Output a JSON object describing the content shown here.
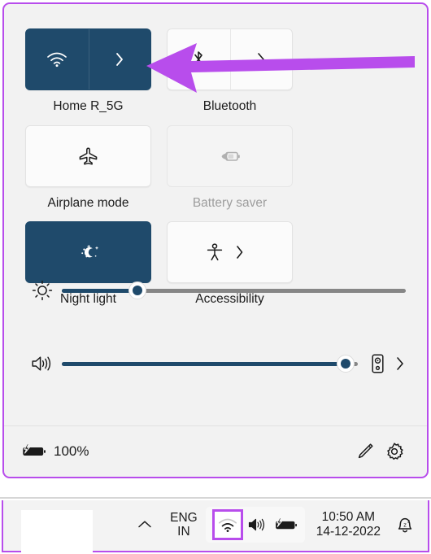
{
  "panel": {
    "name": "quick-settings",
    "accent_on_color": "#1f4a6b",
    "annotation_color": "#b84dec",
    "tiles": [
      {
        "id": "wifi",
        "label": "Home R_5G",
        "icon": "wifi-icon",
        "state": "on",
        "has_chevron": true,
        "chevron": "›"
      },
      {
        "id": "bluetooth",
        "label": "Bluetooth",
        "icon": "bluetooth-icon",
        "state": "off",
        "has_chevron": true,
        "chevron": "›"
      },
      {
        "id": "airplane-mode",
        "label": "Airplane mode",
        "icon": "airplane-icon",
        "state": "off",
        "has_chevron": false,
        "chevron": ""
      },
      {
        "id": "battery-saver",
        "label": "Battery saver",
        "icon": "battery-saver-icon",
        "state": "disabled",
        "has_chevron": false,
        "chevron": ""
      },
      {
        "id": "night-light",
        "label": "Night light",
        "icon": "moon-stars-icon",
        "state": "on",
        "has_chevron": false,
        "chevron": ""
      },
      {
        "id": "accessibility",
        "label": "Accessibility",
        "icon": "accessibility-icon",
        "state": "off",
        "has_chevron": true,
        "chevron": "›"
      }
    ],
    "sliders": [
      {
        "id": "brightness",
        "icon": "brightness-icon",
        "value": 22,
        "min": 0,
        "max": 100,
        "trailing": []
      },
      {
        "id": "volume",
        "icon": "volume-icon",
        "value": 96,
        "min": 0,
        "max": 100,
        "trailing": [
          "speaker-select-icon",
          "chevron-right-icon"
        ]
      }
    ],
    "footer": {
      "battery_icon": "battery-charging-icon",
      "battery_percent": "100%",
      "edit_icon": "pencil-icon",
      "settings_icon": "gear-icon"
    }
  },
  "taskbar": {
    "overflow_chevron": "˄",
    "language": {
      "line1": "ENG",
      "line2": "IN"
    },
    "tray_icons": [
      {
        "id": "wifi",
        "icon": "wifi-icon",
        "highlighted": true
      },
      {
        "id": "volume",
        "icon": "volume-icon",
        "highlighted": false
      },
      {
        "id": "battery",
        "icon": "battery-charging-icon",
        "highlighted": false
      }
    ],
    "clock": {
      "time": "10:50 AM",
      "date": "14-12-2022"
    },
    "notification_icon": "bell-dnd-icon"
  }
}
